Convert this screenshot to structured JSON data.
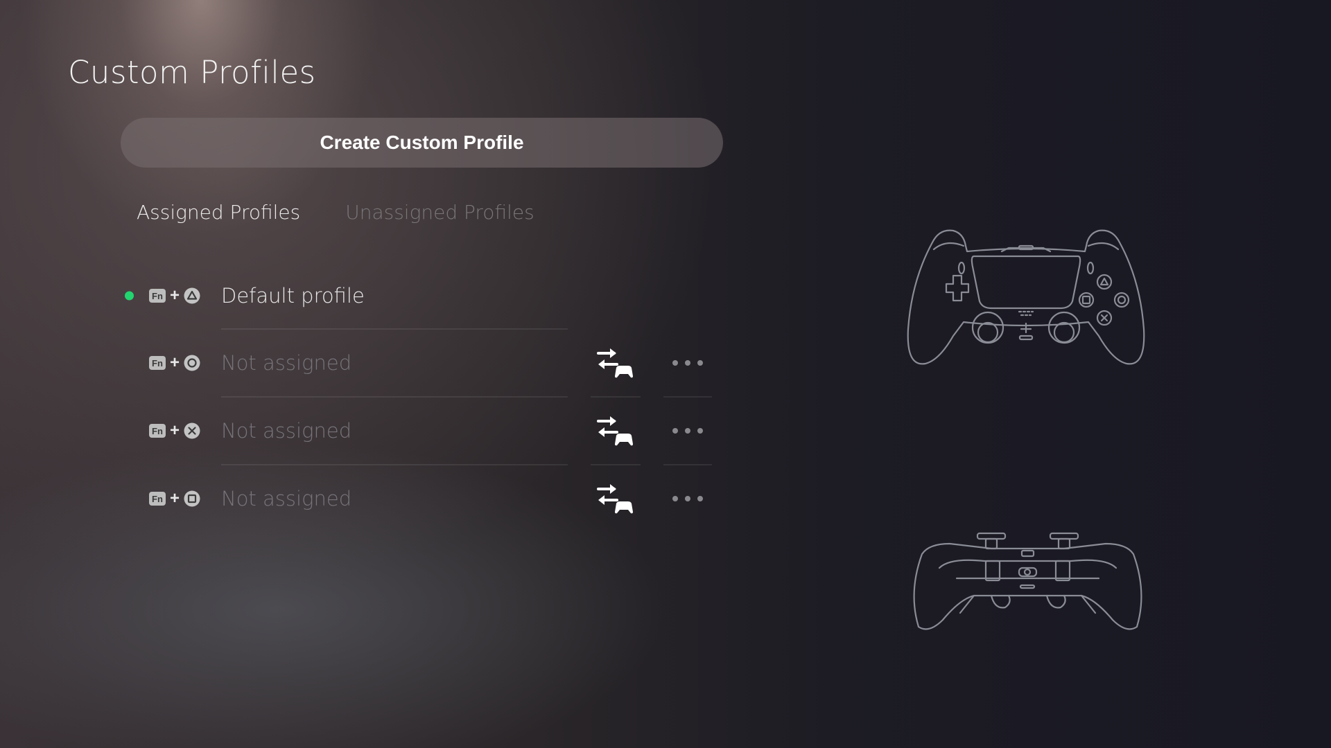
{
  "page": {
    "title": "Custom Profiles"
  },
  "actions": {
    "create_label": "Create Custom Profile"
  },
  "tabs": [
    {
      "label": "Assigned Profiles",
      "active": true
    },
    {
      "label": "Unassigned Profiles",
      "active": false
    }
  ],
  "profiles": [
    {
      "shortcut_key": "Fn",
      "shortcut_button": "triangle",
      "name": "Default profile",
      "active": true,
      "status_color": "#22d56f"
    },
    {
      "shortcut_key": "Fn",
      "shortcut_button": "circle",
      "name": "Not assigned",
      "active": false
    },
    {
      "shortcut_key": "Fn",
      "shortcut_button": "cross",
      "name": "Not assigned",
      "active": false
    },
    {
      "shortcut_key": "Fn",
      "shortcut_button": "square",
      "name": "Not assigned",
      "active": false
    }
  ],
  "icons": {
    "swap": "switch-controller-icon",
    "more": "more-options-icon"
  },
  "images": {
    "controller_front": "dualsense-edge-front-outline",
    "controller_back": "dualsense-edge-back-outline"
  }
}
